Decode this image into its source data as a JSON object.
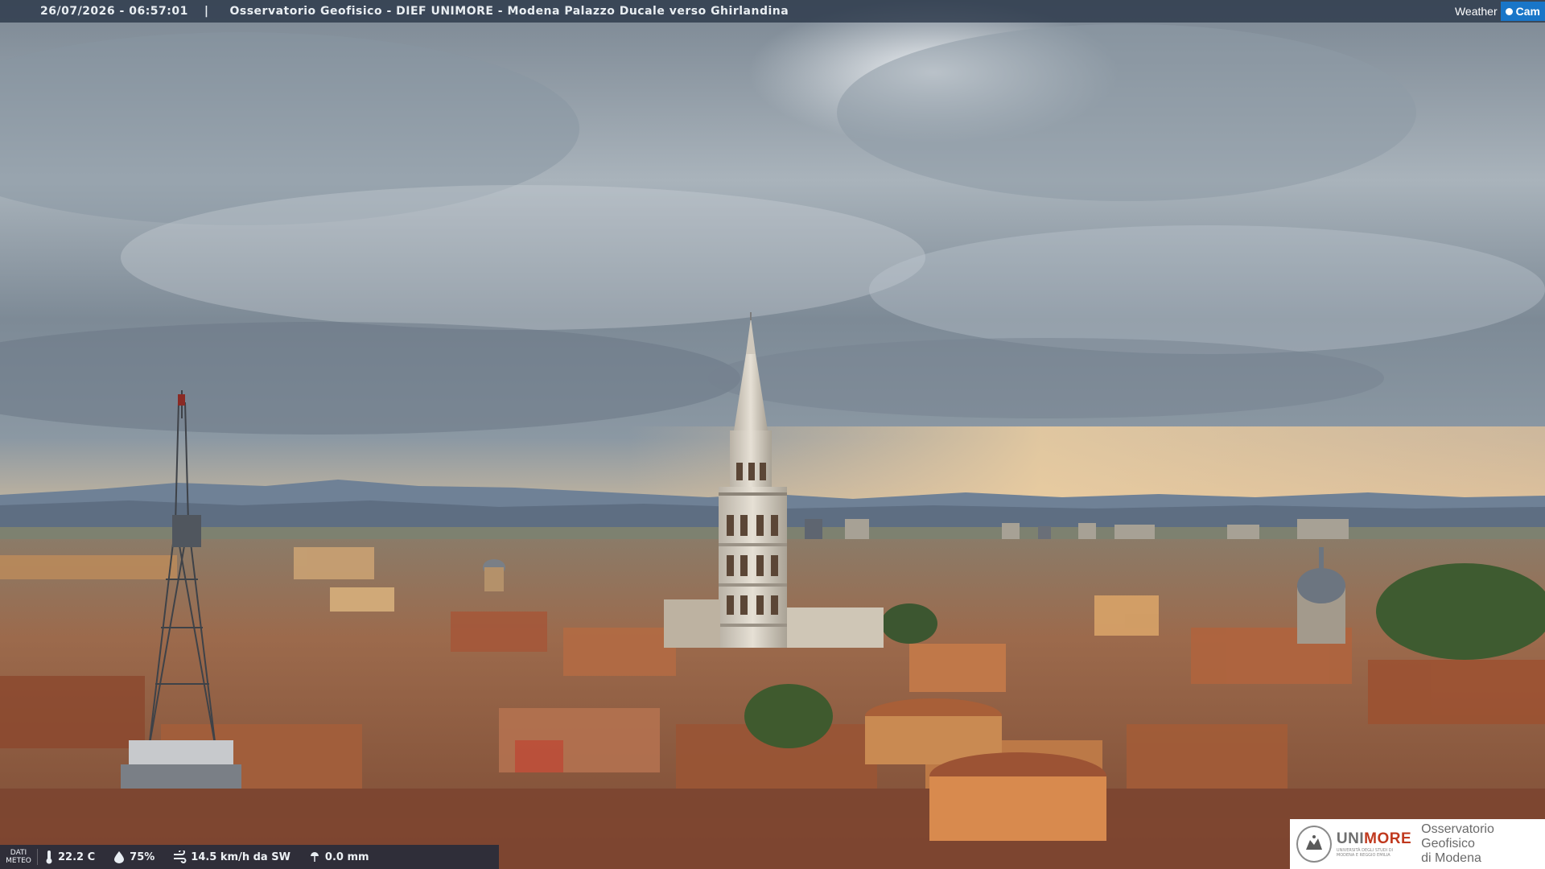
{
  "overlay": {
    "timestamp": "26/07/2026 - 06:57:01",
    "separator": "|",
    "caption": "Osservatorio Geofisico - DIEF UNIMORE - Modena Palazzo Ducale verso Ghirlandina",
    "brand_left": "Weather",
    "brand_right": "Cam"
  },
  "meteo": {
    "label_line1": "DATI",
    "label_line2": "METEO",
    "temperature": "22.2 C",
    "humidity": "75%",
    "wind": "14.5 km/h da SW",
    "rain": "0.0 mm",
    "icons": [
      "thermometer-icon",
      "humidity-icon",
      "wind-icon",
      "rain-gauge-icon"
    ]
  },
  "logo": {
    "university": "UNIMORE",
    "university_sub": "UNIVERSITÀ DEGLI STUDI DI MODENA E REGGIO EMILIA",
    "observatory_line1": "Osservatorio Geofisico",
    "observatory_line2": "di Modena"
  },
  "colors": {
    "sky_top": "#6f7d89",
    "sky_mid": "#9aa6b0",
    "horizon_glow": "#e9c79c",
    "mountains": "#6b7d92",
    "roofs": "#9c5a3a",
    "tower_stone": "#d9d3c8",
    "brand_blue": "#1976c8",
    "unimore_red": "#c0391e"
  }
}
